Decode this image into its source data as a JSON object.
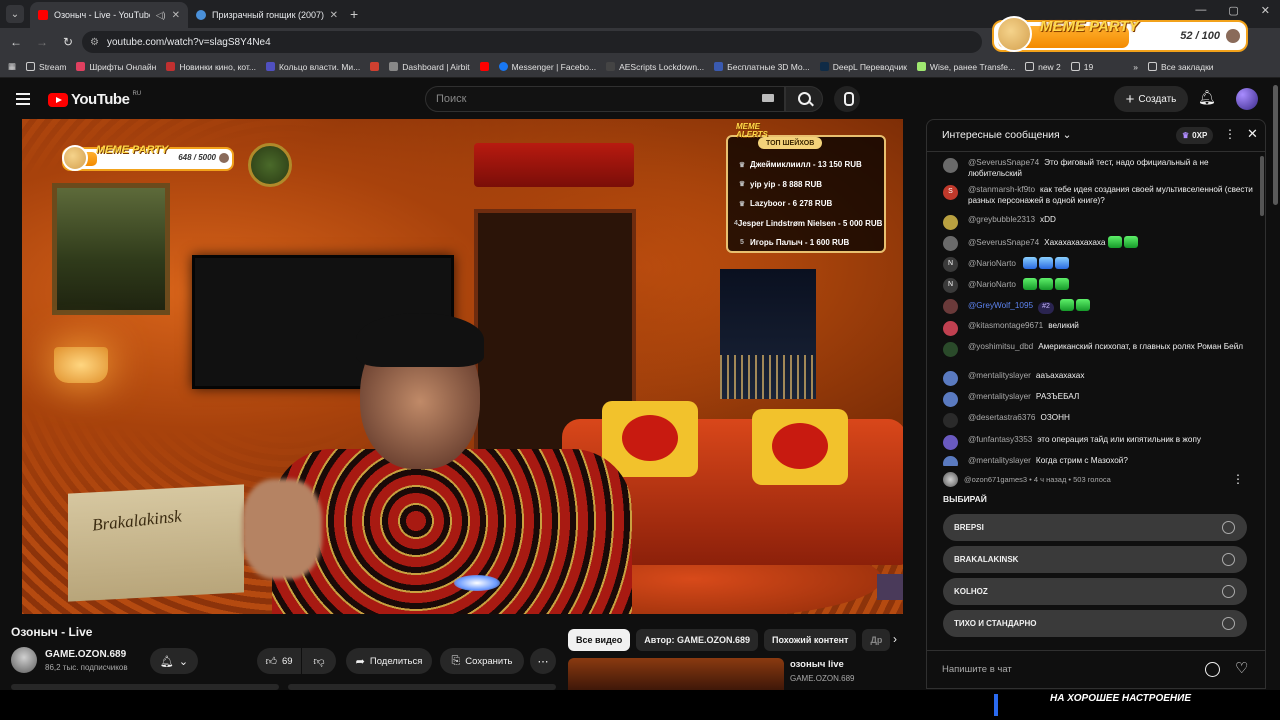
{
  "browser": {
    "tabs": [
      {
        "title": "Озоныч - Live - YouTube",
        "active": true
      },
      {
        "title": "Призрачный гонщик (2007)",
        "active": false
      }
    ],
    "url": "youtube.com/watch?v=slagS8Y4Ne4",
    "bookmarks": [
      "Stream",
      "Шрифты Онлайн",
      "Новинки кино, кот...",
      "Кольцо власти. Ми...",
      "Dashboard | Airbit",
      "Messenger | Facebo...",
      "AEScripts Lockdown...",
      "Бесплатные 3D Mo...",
      "DeepL Переводчик",
      "Wise, ранее Transfe...",
      "new 2",
      "19",
      "Все закладки"
    ]
  },
  "meme_overlay": {
    "brand": "MEME PARTY",
    "count": "52 / 100",
    "progress": 0.52
  },
  "youtube": {
    "logo": "YouTube",
    "region": "RU",
    "search_placeholder": "Поиск",
    "create_label": "Создать"
  },
  "video_overlay": {
    "meme_brand": "MEME PARTY",
    "meme_count": "648 / 5000",
    "alerts_title": "MEME ALERTS",
    "alerts_badge": "ТОП ШЕЙХОВ",
    "top_donors": [
      {
        "rank": "",
        "text": "Джеймиклиилл - 13 150 RUB"
      },
      {
        "rank": "",
        "text": "yip yip - 8 888 RUB"
      },
      {
        "rank": "",
        "text": "Lazyboor - 6 278 RUB"
      },
      {
        "rank": "4",
        "text": "Jesper Lindstrøm Nielsen - 5 000 RUB"
      },
      {
        "rank": "5",
        "text": "Игорь Палыч - 1 600 RUB"
      }
    ],
    "box_label": "Brakalakinsk"
  },
  "video": {
    "title": "Озоныч - Live",
    "channel": "GAME.OZON.689",
    "subscribers": "86,2 тыс. подписчиков",
    "likes": "69",
    "share_label": "Поделиться",
    "save_label": "Сохранить"
  },
  "filter_chips": [
    "Все видео",
    "Автор: GAME.OZON.689",
    "Похожий контент",
    "Др"
  ],
  "related": {
    "title": "озоныч live",
    "channel": "GAME.OZON.689"
  },
  "chat": {
    "header": "Интересные сообщения",
    "xp_label": "0XP",
    "messages": [
      {
        "author": "@SeverusSnape74",
        "text": "Это фиговый тест, надо официальный а не любительский",
        "color": "#6a6a6a",
        "initial": ""
      },
      {
        "author": "@stanmarsh-kf9to",
        "text": "как тебе идея создания своей мультивселенной (свести разных персонажей в одной книге)?",
        "color": "#c0392b",
        "initial": "S"
      },
      {
        "author": "@greybubble2313",
        "text": "xDD",
        "color": "#b8a040",
        "initial": ""
      },
      {
        "author": "@SeverusSnape74",
        "text": "Хахахахахахаха",
        "color": "#6a6a6a",
        "initial": "",
        "emotes": [
          "g",
          "g"
        ]
      },
      {
        "author": "@NarioNarto",
        "text": "",
        "color": "#3a3a3a",
        "initial": "N",
        "emotes": [
          "b",
          "b",
          "b"
        ]
      },
      {
        "author": "@NarioNarto",
        "text": "",
        "color": "#3a3a3a",
        "initial": "N",
        "emotes": [
          "g",
          "g",
          "g"
        ]
      },
      {
        "author": "@GreyWolf_1095",
        "text": "",
        "color": "#6a3a3a",
        "initial": "",
        "rank": "#2",
        "emotes": [
          "g",
          "g"
        ],
        "member": true
      },
      {
        "author": "@kitasmontage9671",
        "text": "великий",
        "color": "#c04050",
        "initial": ""
      },
      {
        "author": "@yoshimitsu_dbd",
        "text": "Американский психопат, в главных ролях Роман Бейл",
        "color": "#2a4a2a",
        "initial": ""
      },
      {
        "author": "@mentalityslayer",
        "text": "ааъахахахах",
        "color": "#5a7ac0",
        "initial": ""
      },
      {
        "author": "@mentalityslayer",
        "text": "РАЗЪЕБАЛ",
        "color": "#5a7ac0",
        "initial": ""
      },
      {
        "author": "@desertastra6376",
        "text": "ОЗОНН",
        "color": "#2a2a2a",
        "initial": ""
      },
      {
        "author": "@funfantasy3353",
        "text": "это операция тайд или кипятильник в жопу",
        "color": "#6a5ac0",
        "initial": ""
      },
      {
        "author": "@mentalityslayer",
        "text": "Когда стрим с Мазохой?",
        "color": "#5a7ac0",
        "initial": ""
      }
    ],
    "poll": {
      "meta": "@ozon671games3 • 4 ч назад • 503 голоса",
      "question": "ВЫБИРАЙ",
      "options": [
        "BREPSI",
        "BRAKALAKINSK",
        "KOLHOZ",
        "ТИХО И СТАНДАРНО"
      ]
    },
    "input_placeholder": "Напишите в чат"
  },
  "caption": "НА ХОРОШЕЕ НАСТРОЕНИЕ"
}
